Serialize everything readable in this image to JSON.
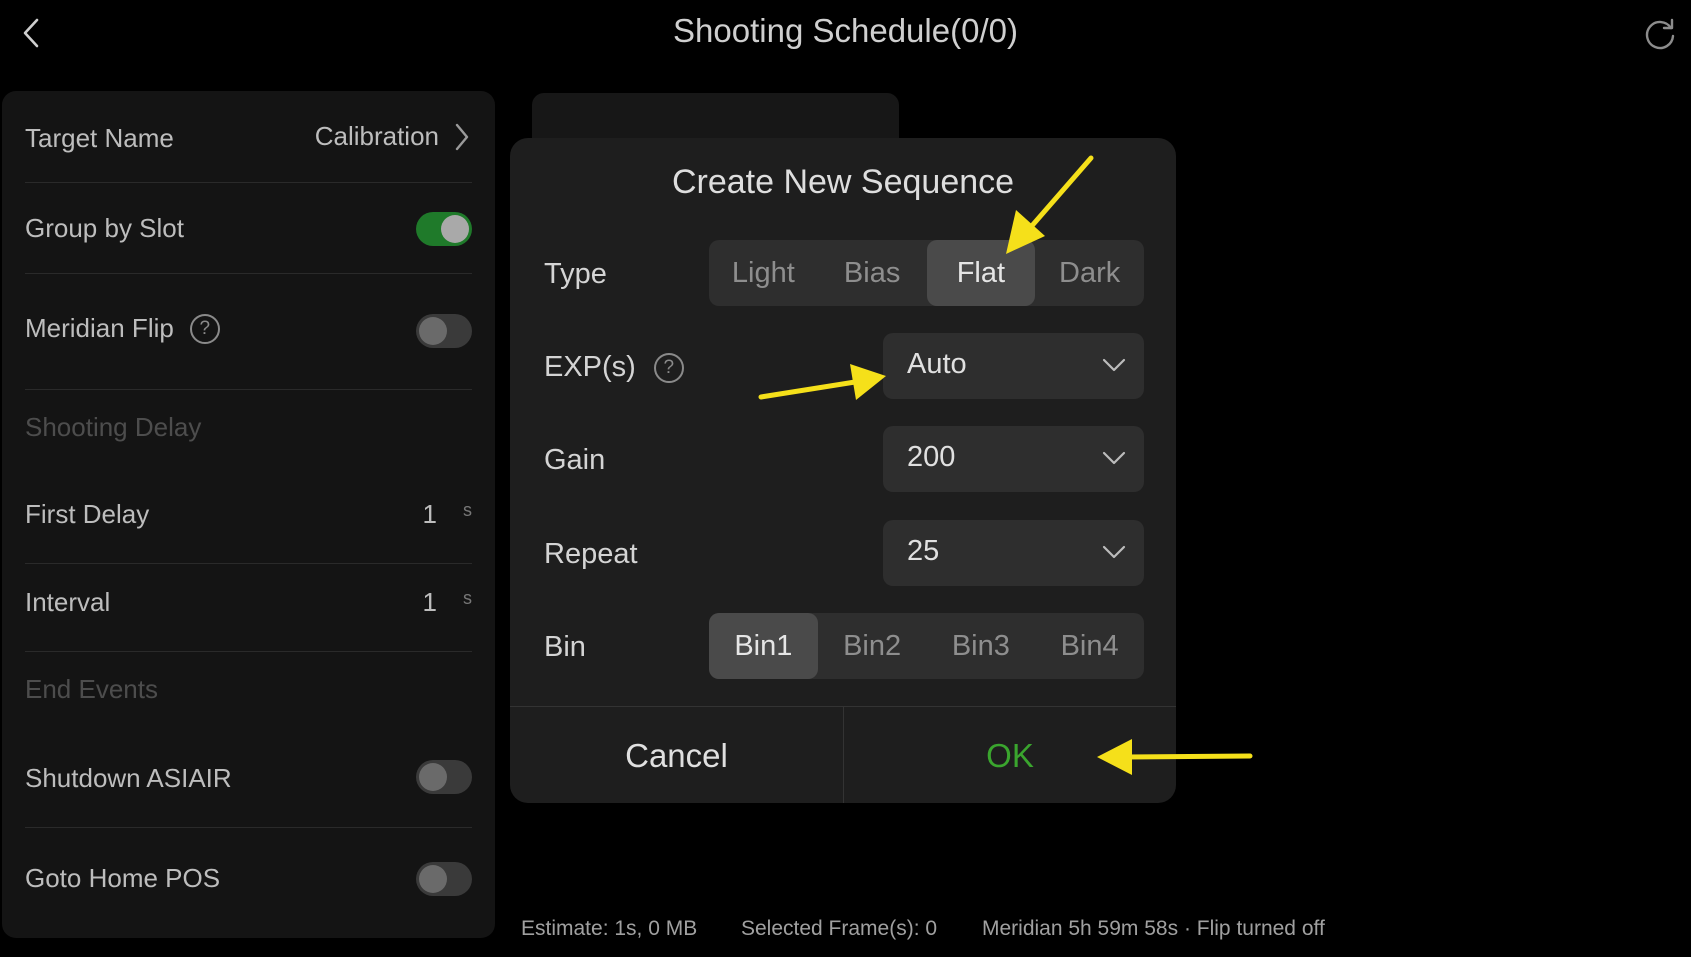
{
  "header": {
    "title": "Shooting Schedule(0/0)"
  },
  "left_panel": {
    "target_name": {
      "label": "Target Name",
      "value": "Calibration"
    },
    "group_by_slot": {
      "label": "Group by Slot",
      "on": true
    },
    "meridian_flip": {
      "label": "Meridian Flip",
      "help": "?",
      "on": false
    },
    "shooting_delay": {
      "label": "Shooting Delay"
    },
    "first_delay": {
      "label": "First Delay",
      "value": "1",
      "unit": "s"
    },
    "interval": {
      "label": "Interval",
      "value": "1",
      "unit": "s"
    },
    "end_events": {
      "label": "End Events"
    },
    "shutdown_asiair": {
      "label": "Shutdown ASIAIR",
      "on": false
    },
    "goto_home_pos": {
      "label": "Goto Home POS",
      "on": false
    }
  },
  "dialog": {
    "title": "Create New Sequence",
    "type": {
      "label": "Type",
      "options": [
        "Light",
        "Bias",
        "Flat",
        "Dark"
      ],
      "selected": "Flat"
    },
    "exp": {
      "label": "EXP(s)",
      "help": "?",
      "value": "Auto"
    },
    "gain": {
      "label": "Gain",
      "value": "200"
    },
    "repeat": {
      "label": "Repeat",
      "value": "25"
    },
    "bin": {
      "label": "Bin",
      "options": [
        "Bin1",
        "Bin2",
        "Bin3",
        "Bin4"
      ],
      "selected": "Bin1"
    },
    "cancel_label": "Cancel",
    "ok_label": "OK"
  },
  "status": {
    "estimate": "Estimate: 1s, 0 MB",
    "selected_frames": "Selected Frame(s): 0",
    "meridian": "Meridian 5h 59m 58s · Flip turned off"
  },
  "colors": {
    "ok_green": "#3aa52e",
    "toggle_on": "#1f7a2a",
    "annotation_arrow": "#f5e01a"
  },
  "icons": {
    "back": "chevron-left-icon",
    "refresh": "refresh-icon",
    "target_chevron": "chevron-right-icon",
    "help": "help-circle-icon",
    "dropdown": "chevron-down-icon"
  }
}
